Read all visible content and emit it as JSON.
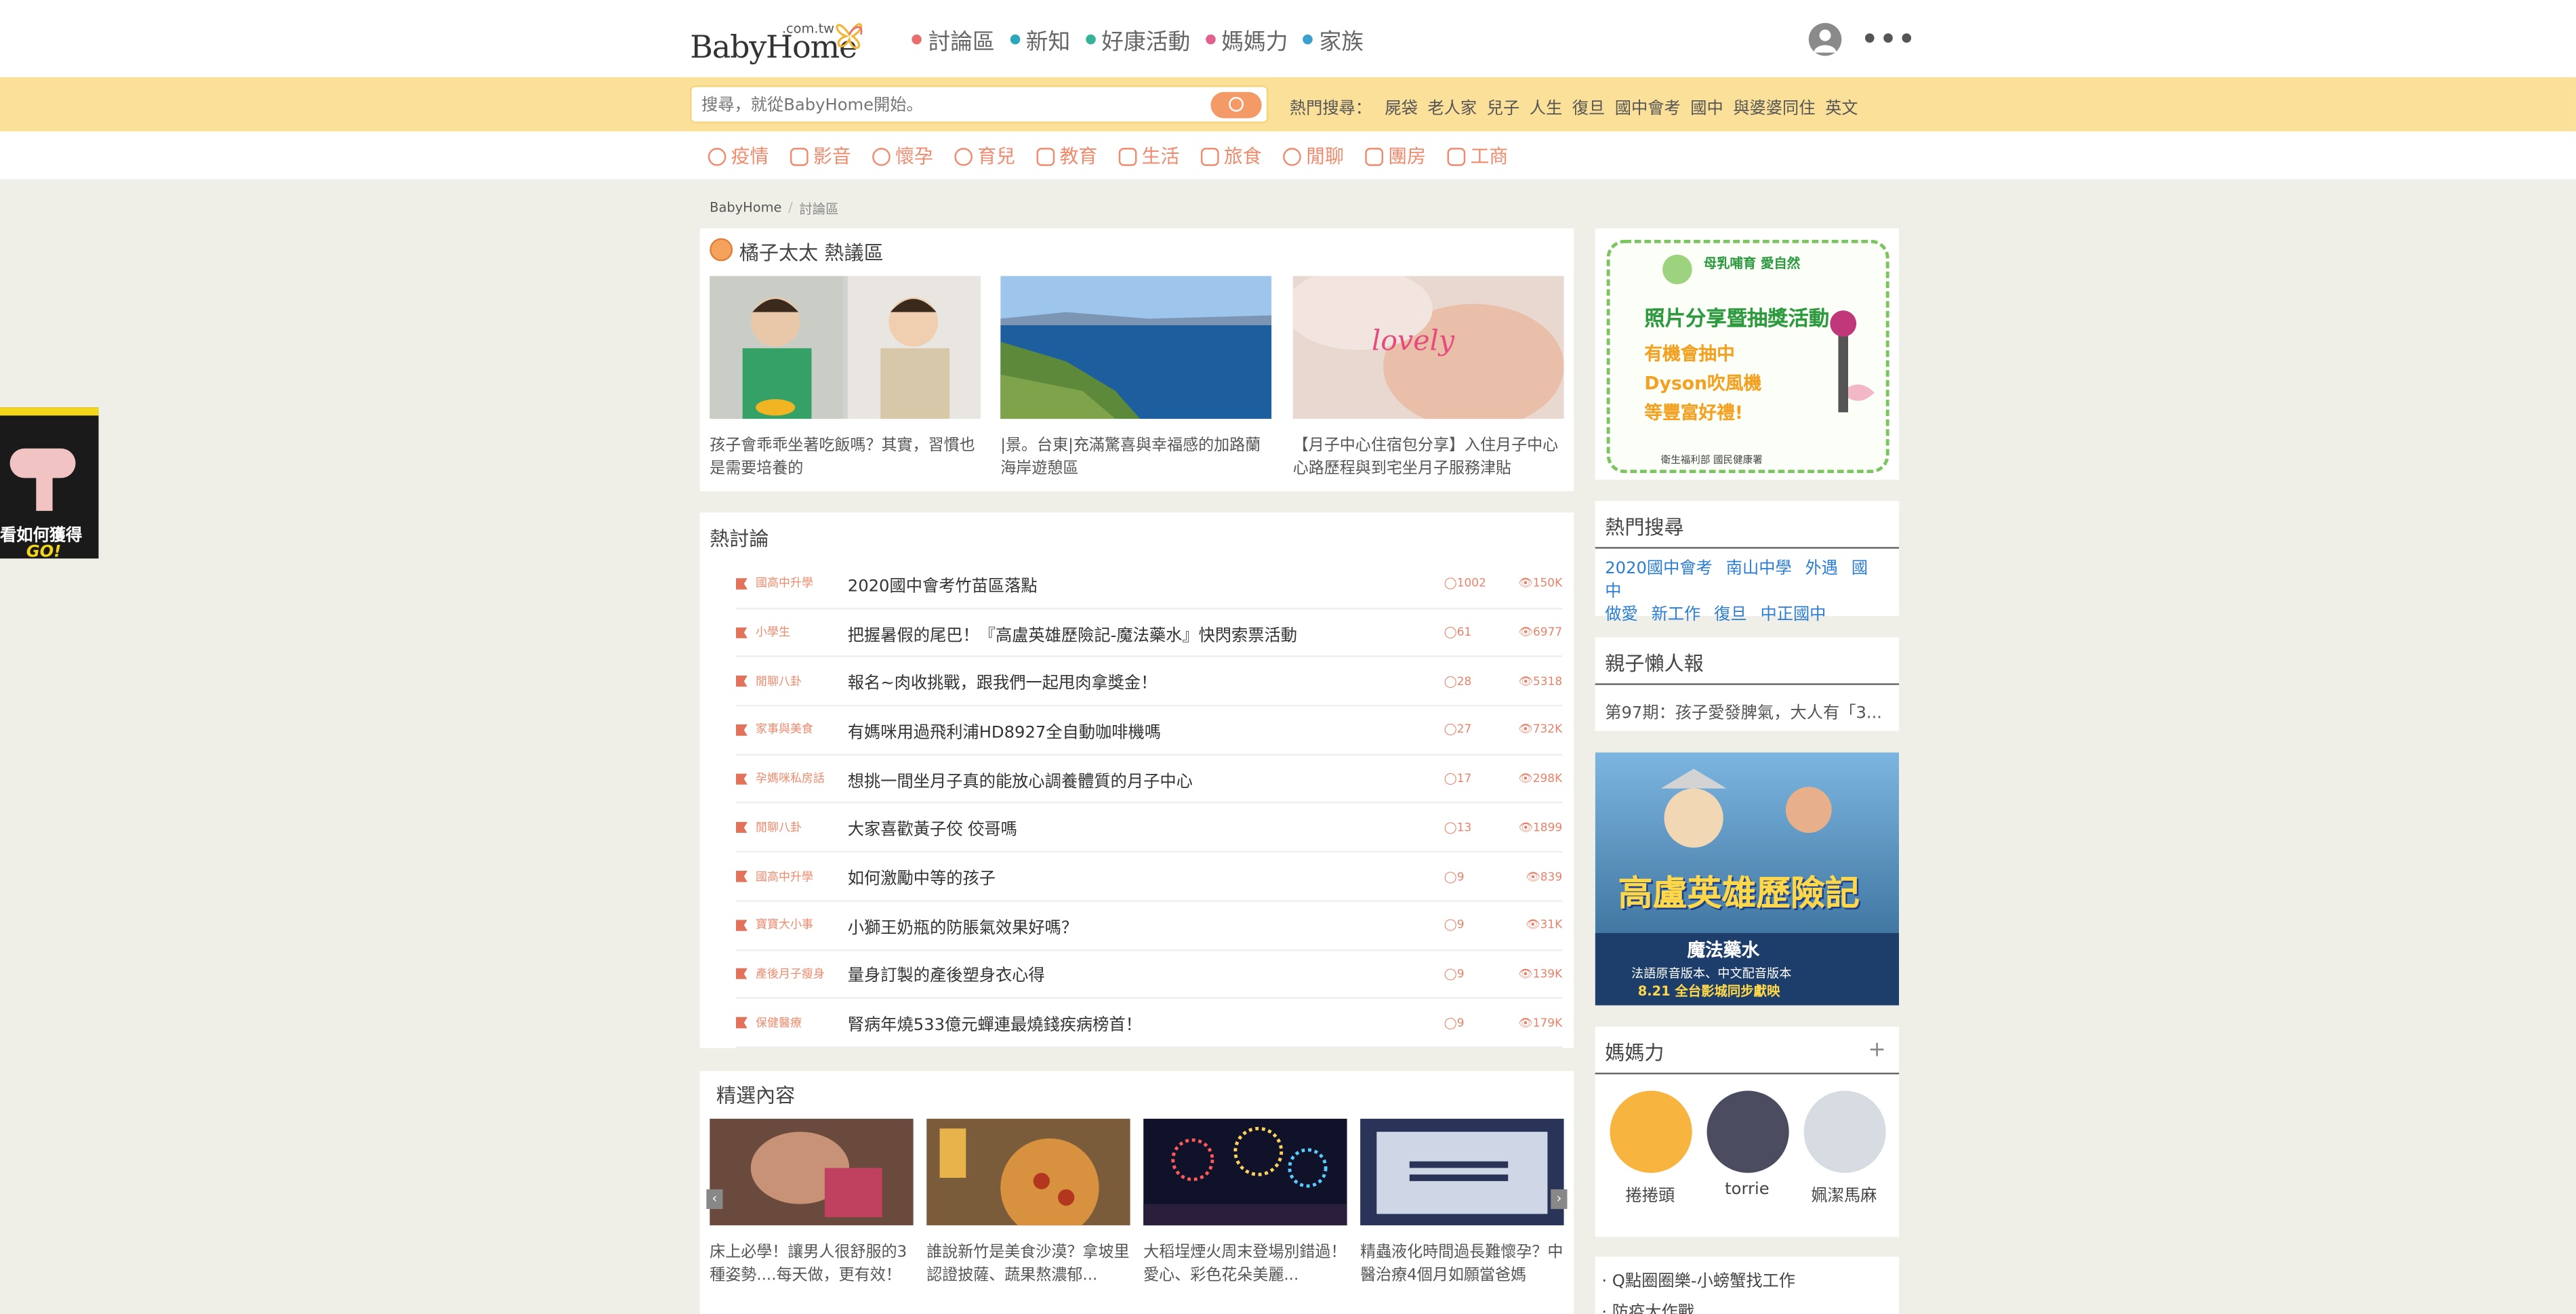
{
  "header": {
    "logo_text": "BabyHome",
    "logo_domain": ".com.tw",
    "nav": [
      {
        "label": "討論區",
        "color": "#e86f6f"
      },
      {
        "label": "新知",
        "color": "#2aa7b8"
      },
      {
        "label": "好康活動",
        "color": "#35b39a"
      },
      {
        "label": "媽媽力",
        "color": "#e0608f"
      },
      {
        "label": "家族",
        "color": "#3b9fd0"
      }
    ]
  },
  "search": {
    "placeholder": "搜尋，就從BabyHome開始。",
    "hot_label": "熱門搜尋：",
    "hot_terms": [
      "屍袋",
      "老人家",
      "兒子",
      "人生",
      "復旦",
      "國中會考",
      "國中",
      "與婆婆同住",
      "英文"
    ]
  },
  "categories": [
    "疫情",
    "影音",
    "懷孕",
    "育兒",
    "教育",
    "生活",
    "旅食",
    "閒聊",
    "團房",
    "工商"
  ],
  "breadcrumb": {
    "home": "BabyHome",
    "current": "討論區"
  },
  "orange_zone": {
    "title": "橘子太太 熱議區",
    "cards": [
      {
        "caption": "孩子會乖乖坐著吃飯嗎？其實，習慣也是需要培養的"
      },
      {
        "caption": "|景。台東|充滿驚喜與幸福感的加路蘭海岸遊憩區"
      },
      {
        "caption": "【月子中心住宿包分享】入住月子中心心路歷程與到宅坐月子服務津貼"
      }
    ],
    "overlay_text": "lovely"
  },
  "hot_discussions": {
    "title": "熱討論",
    "rows": [
      {
        "tag": "國高中升學",
        "title": "2020國中會考竹苗區落點",
        "comments": "1002",
        "views": "150K"
      },
      {
        "tag": "小學生",
        "title": "把握暑假的尾巴！『高盧英雄歷險記-魔法藥水』快閃索票活動",
        "comments": "61",
        "views": "6977"
      },
      {
        "tag": "閒聊八卦",
        "title": "報名~肉收挑戰，跟我們一起甩肉拿獎金！",
        "comments": "28",
        "views": "5318"
      },
      {
        "tag": "家事與美食",
        "title": "有媽咪用過飛利浦HD8927全自動咖啡機嗎",
        "comments": "27",
        "views": "732K"
      },
      {
        "tag": "孕媽咪私房話",
        "title": "想挑一間坐月子真的能放心調養體質的月子中心",
        "comments": "17",
        "views": "298K"
      },
      {
        "tag": "閒聊八卦",
        "title": "大家喜歡黃子佼 佼哥嗎",
        "comments": "13",
        "views": "1899"
      },
      {
        "tag": "國高中升學",
        "title": "如何激勵中等的孩子",
        "comments": "9",
        "views": "839"
      },
      {
        "tag": "寶寶大小事",
        "title": "小獅王奶瓶的防脹氣效果好嗎？",
        "comments": "9",
        "views": "31K"
      },
      {
        "tag": "產後月子瘦身",
        "title": "量身訂製的產後塑身衣心得",
        "comments": "9",
        "views": "139K"
      },
      {
        "tag": "保健醫療",
        "title": "腎病年燒533億元蟬連最燒錢疾病榜首！",
        "comments": "9",
        "views": "179K"
      }
    ]
  },
  "featured": {
    "title": "精選內容",
    "cards": [
      {
        "caption": "床上必學！讓男人很舒服的3種姿勢....每天做，更有效！"
      },
      {
        "caption": "誰說新竹是美食沙漠？拿坡里認證披薩、蔬果熬濃郁..."
      },
      {
        "caption": "大稻埕煙火周末登場別錯過！愛心、彩色花朵美麗..."
      },
      {
        "caption": "精蟲液化時間過長難懷孕？中醫治療4個月如願當爸媽"
      }
    ],
    "prev_arrow": "‹",
    "next_arrow": "›"
  },
  "sidebar": {
    "ad_top": {
      "line1": "母乳哺育 愛自然",
      "line2": "照片分享暨抽獎活動",
      "line3": "有機會抽中",
      "line4": "Dyson吹風機",
      "line5": "等豐富好禮!",
      "footer": "衛生福利部 國民健康署"
    },
    "hot_search": {
      "title": "熱門搜尋",
      "links": [
        "2020國中會考",
        "南山中學",
        "外遇",
        "國中",
        "做愛",
        "新工作",
        "復旦",
        "中正國中"
      ]
    },
    "lazy_news": {
      "title": "親子懶人報",
      "item": "第97期：孩子愛發脾氣，大人有「3..."
    },
    "movie_ad": {
      "title": "高盧英雄歷險記",
      "subtitle": "魔法藥水",
      "line": "法語原音版本、中文配音版本",
      "date": "8.21 全台影城同步獻映"
    },
    "moms": {
      "title": "媽媽力",
      "plus": "+",
      "people": [
        {
          "name": "捲捲頭",
          "color": "#f7b540"
        },
        {
          "name": "torrie",
          "color": "#4c4c60"
        },
        {
          "name": "姵潔馬麻",
          "color": "#d7dce2"
        }
      ]
    },
    "last_panel": [
      "· Q點圈圈樂-小螃蟹找工作",
      "· 防疫大作戰"
    ]
  },
  "side_ad": {
    "line1": "看如何獲得",
    "line2": "GO!"
  }
}
